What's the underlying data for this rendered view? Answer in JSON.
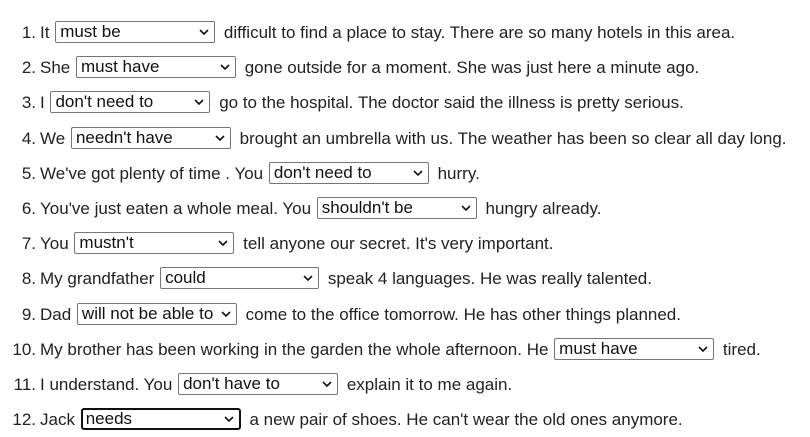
{
  "items": [
    {
      "num": "1.",
      "before": "It",
      "selected": "must be",
      "after": "difficult to find a place to stay. There are so many hotels in this area."
    },
    {
      "num": "2.",
      "before": "She",
      "selected": "must have",
      "after": "gone outside for a moment. She was just here a minute ago."
    },
    {
      "num": "3.",
      "before": "I",
      "selected": "don't need to",
      "after": "go to the hospital. The doctor said the illness is pretty serious."
    },
    {
      "num": "4.",
      "before": "We",
      "selected": "needn't have",
      "after": "brought an umbrella with us. The weather has been so clear all day long."
    },
    {
      "num": "5.",
      "before": "We've got plenty of time . You",
      "selected": "don't need to",
      "after": "hurry."
    },
    {
      "num": "6.",
      "before": "You've just eaten a whole meal. You",
      "selected": "shouldn't be",
      "after": "hungry already."
    },
    {
      "num": "7.",
      "before": "You",
      "selected": "mustn't",
      "after": "tell anyone our secret. It's very important."
    },
    {
      "num": "8.",
      "before": "My grandfather",
      "selected": "could",
      "after": "speak 4 languages. He was really talented."
    },
    {
      "num": "9.",
      "before": "Dad",
      "selected": "will not be able to",
      "after": "come to the office tomorrow. He has other things planned."
    },
    {
      "num": "10.",
      "before": "My brother has been working in the garden the whole afternoon. He",
      "selected": "must have",
      "after": "tired."
    },
    {
      "num": "11.",
      "before": "I understand. You",
      "selected": "don't have to",
      "after": "explain it to me again."
    },
    {
      "num": "12.",
      "before": "Jack",
      "selected": "needs",
      "after": "a new pair of shoes. He can't wear the old ones anymore."
    }
  ],
  "dropdown_icon": "chevron-down-icon",
  "focused_item": "12."
}
